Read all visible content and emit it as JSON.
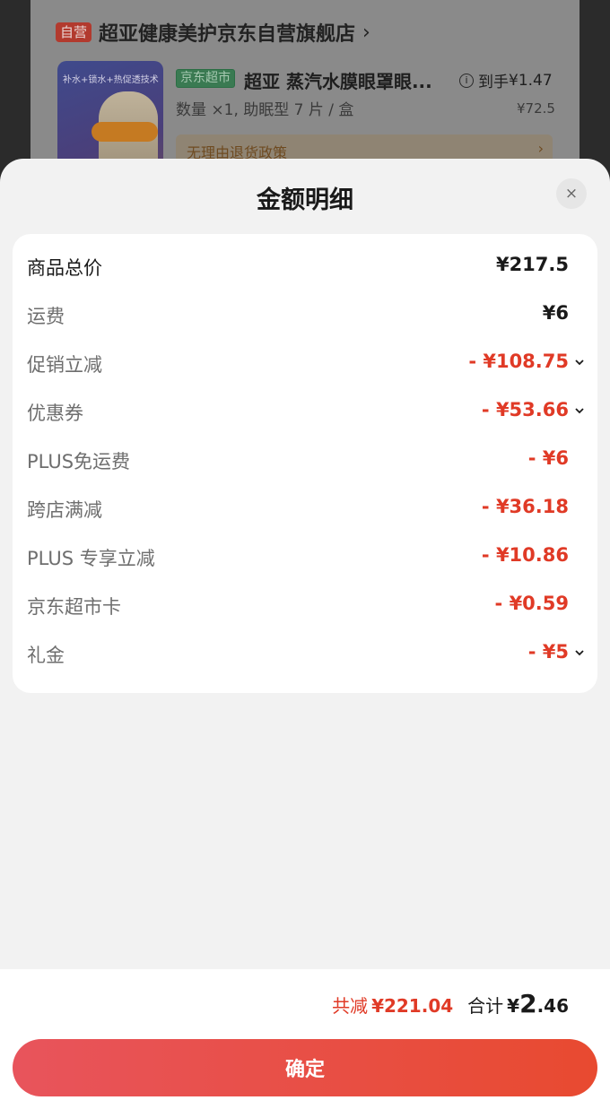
{
  "store": {
    "self_tag": "自营",
    "name": "超亚健康美护京东自营旗舰店",
    "chevron": "›"
  },
  "product": {
    "thumb_text": "补水+锁水+热促透技术",
    "market_tag": "京东超市",
    "title": "超亚 蒸汽水膜眼罩眼...",
    "info_icon": "i",
    "arrival_label": "到手",
    "arrival_price": "¥1.47",
    "quantity_spec": "数量 ×1, 助眠型 7 片 / 盒",
    "original_price": "¥72.5",
    "policy": "无理由退货政策",
    "policy_chevron": "›"
  },
  "sheet": {
    "title": "金额明细",
    "close_icon": "×",
    "rows": [
      {
        "label": "商品总价",
        "value": "¥217.5",
        "negative": false,
        "expandable": false
      },
      {
        "label": "运费",
        "value": "¥6",
        "negative": false,
        "expandable": false
      },
      {
        "label": "促销立减",
        "value": "- ¥108.75",
        "negative": true,
        "expandable": true
      },
      {
        "label": "优惠券",
        "value": "- ¥53.66",
        "negative": true,
        "expandable": true
      },
      {
        "label": "PLUS免运费",
        "value": "- ¥6",
        "negative": true,
        "expandable": false
      },
      {
        "label": "跨店满减",
        "value": "- ¥36.18",
        "negative": true,
        "expandable": false
      },
      {
        "label": "PLUS 专享立减",
        "value": "- ¥10.86",
        "negative": true,
        "expandable": false
      },
      {
        "label": "京东超市卡",
        "value": "- ¥0.59",
        "negative": true,
        "expandable": false
      },
      {
        "label": "礼金",
        "value": "- ¥5",
        "negative": true,
        "expandable": true
      }
    ]
  },
  "summary": {
    "saved_label": "共减",
    "saved_amount": "¥221.04",
    "total_label": "合计",
    "total_currency": "¥",
    "total_integer": "2",
    "total_decimal": ".46"
  },
  "confirm_label": "确定",
  "colors": {
    "accent_red": "#e03a26",
    "market_green": "#3a7a52",
    "sheet_bg": "#f2f2f2"
  }
}
